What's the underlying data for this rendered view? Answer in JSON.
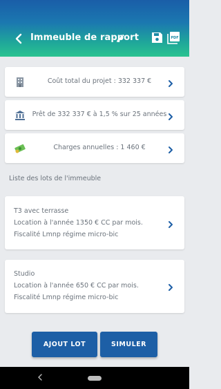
{
  "header": {
    "title": "Immeuble de rapport",
    "gradient_top": "#1a5ea8",
    "gradient_bottom": "#2ac390",
    "icons": [
      "back-arrow-icon",
      "pencil-icon",
      "save-icon",
      "pdf-icon"
    ]
  },
  "summary_cards": [
    {
      "icon": "building-icon",
      "text": "Coût total du projet : 332 337 €"
    },
    {
      "icon": "bank-icon",
      "text": "Prêt de 332 337 € à 1,5 % sur 25 années"
    },
    {
      "icon": "money-icon",
      "text": "Charges annuelles : 1 460 €"
    }
  ],
  "lots_section": {
    "label": "Liste des lots de l'immeuble",
    "lots": [
      {
        "name": "T3 avec terrasse",
        "rent": "Location à l'année 1350 € CC par mois.",
        "tax": "Fiscalité Lmnp régime micro-bic"
      },
      {
        "name": "Studio",
        "rent": "Location à l'année 650 € CC par mois.",
        "tax": "Fiscalité Lmnp régime micro-bic"
      }
    ]
  },
  "actions": {
    "add_lot": "AJOUT LOT",
    "simulate": "SIMULER"
  },
  "colors": {
    "accent": "#1d5fa6",
    "chevron": "#1d5fa6",
    "background": "#e9ebee"
  }
}
